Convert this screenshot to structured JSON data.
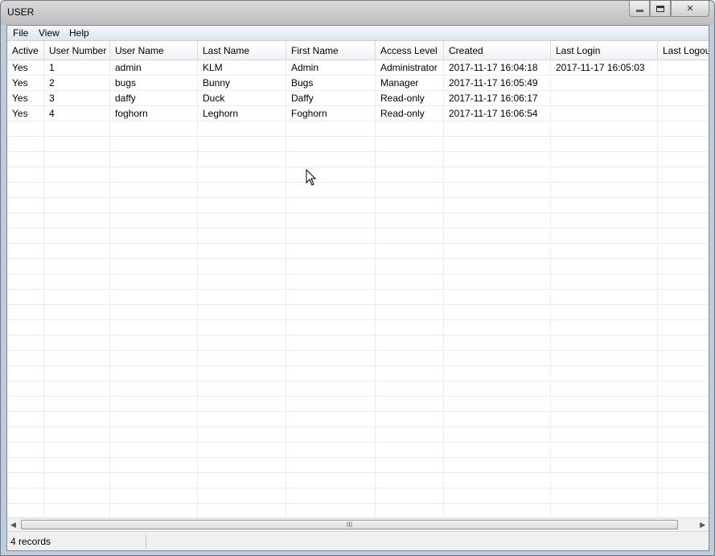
{
  "window": {
    "title": "USER"
  },
  "menu": {
    "items": [
      "File",
      "View",
      "Help"
    ]
  },
  "table": {
    "columns": [
      "Active",
      "User Number",
      "User Name",
      "Last Name",
      "First Name",
      "Access Level",
      "Created",
      "Last Login",
      "Last Logout"
    ],
    "rows": [
      [
        "Yes",
        "1",
        "admin",
        "KLM",
        "Admin",
        "Administrator",
        "2017-11-17 16:04:18",
        "2017-11-17 16:05:03",
        ""
      ],
      [
        "Yes",
        "2",
        "bugs",
        "Bunny",
        "Bugs",
        "Manager",
        "2017-11-17 16:05:49",
        "",
        ""
      ],
      [
        "Yes",
        "3",
        "daffy",
        "Duck",
        "Daffy",
        "Read-only",
        "2017-11-17 16:06:17",
        "",
        ""
      ],
      [
        "Yes",
        "4",
        "foghorn",
        "Leghorn",
        "Foghorn",
        "Read-only",
        "2017-11-17 16:06:54",
        "",
        ""
      ]
    ]
  },
  "scrollbar": {
    "thumb_grip": "III"
  },
  "status": {
    "text": "4 records"
  }
}
